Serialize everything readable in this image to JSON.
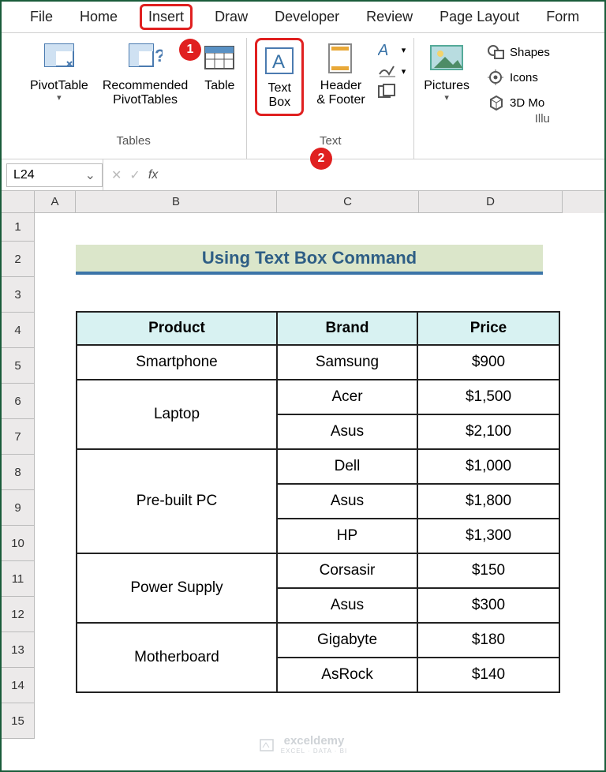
{
  "menu": {
    "tabs": [
      "File",
      "Home",
      "Insert",
      "Draw",
      "Developer",
      "Review",
      "Page Layout",
      "Form"
    ],
    "active": "Insert"
  },
  "ribbon": {
    "tables": {
      "pivot": "PivotTable",
      "recpivot": "Recommended\nPivotTables",
      "table": "Table",
      "group": "Tables"
    },
    "text": {
      "textbox": "Text\nBox",
      "header": "Header\n& Footer",
      "group": "Text"
    },
    "pictures": {
      "label": "Pictures"
    },
    "illus": {
      "shapes": "Shapes",
      "icons": "Icons",
      "models": "3D Mo",
      "group": "Illu"
    }
  },
  "markers": {
    "m1": "1",
    "m2": "2"
  },
  "formula": {
    "namebox": "L24",
    "fx": "fx"
  },
  "cols": [
    "A",
    "B",
    "C",
    "D"
  ],
  "rownums": [
    "1",
    "2",
    "3",
    "4",
    "5",
    "6",
    "7",
    "8",
    "9",
    "10",
    "11",
    "12",
    "13",
    "14",
    "15"
  ],
  "banner": "Using Text Box Command",
  "table": {
    "headers": [
      "Product",
      "Brand",
      "Price"
    ],
    "rows": [
      {
        "p": "Smartphone",
        "span": 1,
        "b": "Samsung",
        "pr": "$900"
      },
      {
        "p": "Laptop",
        "span": 2,
        "b": "Acer",
        "pr": "$1,500"
      },
      {
        "b": "Asus",
        "pr": "$2,100"
      },
      {
        "p": "Pre-built PC",
        "span": 3,
        "b": "Dell",
        "pr": "$1,000"
      },
      {
        "b": "Asus",
        "pr": "$1,800"
      },
      {
        "b": "HP",
        "pr": "$1,300"
      },
      {
        "p": "Power Supply",
        "span": 2,
        "b": "Corsasir",
        "pr": "$150"
      },
      {
        "b": "Asus",
        "pr": "$300"
      },
      {
        "p": "Motherboard",
        "span": 2,
        "b": "Gigabyte",
        "pr": "$180"
      },
      {
        "b": "AsRock",
        "pr": "$140"
      }
    ]
  },
  "watermark": {
    "main": "exceldemy",
    "sub": "EXCEL · DATA · BI"
  }
}
